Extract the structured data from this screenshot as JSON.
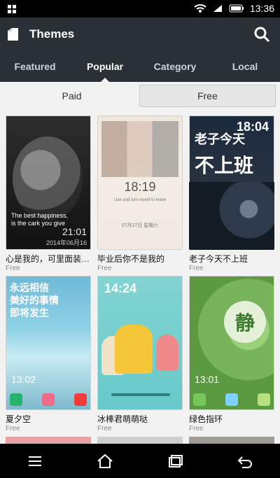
{
  "status": {
    "time": "13:36"
  },
  "header": {
    "title": "Themes"
  },
  "tabs": [
    "Featured",
    "Popular",
    "Category",
    "Local"
  ],
  "segment": [
    "Paid",
    "Free"
  ],
  "themes": [
    {
      "name": "心是我的，可里面装的...",
      "tag": "Free",
      "preview": {
        "caption_line1": "The best happiness,",
        "caption_line2": "is the cark you give",
        "time": "21:01",
        "date": "2014年06月16"
      }
    },
    {
      "name": "毕业后你不是我的",
      "tag": "Free",
      "preview": {
        "time": "18:19",
        "sub": "Use and turn round to leave",
        "date": "07月27日 星期六"
      }
    },
    {
      "name": "老子今天不上班",
      "tag": "Free",
      "preview": {
        "time": "18:04",
        "line1": "老子今天",
        "line2": "不上班"
      }
    },
    {
      "name": "夏夕空",
      "tag": "Free",
      "preview": {
        "line1": "永远相信",
        "line2": "美好的事情",
        "line3": "即将发生",
        "time": "13:02"
      }
    },
    {
      "name": "冰棒君萌萌哒",
      "tag": "Free",
      "preview": {
        "time": "14:24"
      }
    },
    {
      "name": "绿色指环",
      "tag": "Free",
      "preview": {
        "glyph": "静",
        "time": "13:01"
      }
    }
  ],
  "colors": {
    "header_bg": "#2b2f36",
    "page_bg": "#f2f2f2"
  }
}
